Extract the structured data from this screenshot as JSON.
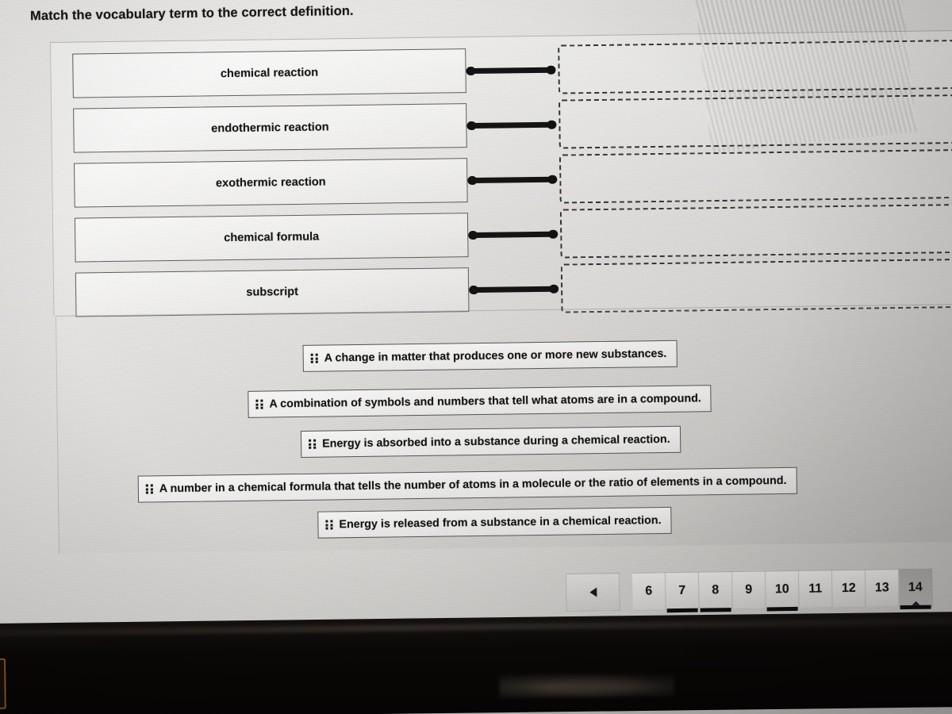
{
  "prompt": "Match the vocabulary term to the correct definition.",
  "match_area": {
    "rows": [
      {
        "term": "chemical reaction",
        "connector": "link-connector",
        "drop_zone_placeholder": ""
      },
      {
        "term": "endothermic reaction",
        "connector": "link-connector",
        "drop_zone_placeholder": ""
      },
      {
        "term": "exothermic reaction",
        "connector": "link-connector",
        "drop_zone_placeholder": ""
      },
      {
        "term": "chemical formula",
        "connector": "link-connector",
        "drop_zone_placeholder": ""
      },
      {
        "term": "subscript",
        "connector": "link-connector",
        "drop_zone_placeholder": ""
      }
    ]
  },
  "definition_bank": {
    "items": [
      {
        "text": "A change in matter that produces one or more new substances."
      },
      {
        "text": "A combination of symbols and numbers that tell what atoms are in a compound."
      },
      {
        "text": "Energy is absorbed into a substance during a chemical reaction."
      },
      {
        "text": "A number in a chemical formula that tells the number of atoms in a molecule or the ratio of elements in a compound."
      },
      {
        "text": "Energy is released from a substance in a chemical reaction."
      }
    ]
  },
  "pagination": {
    "prev_label": "",
    "prev_icon": "triangle-left-icon",
    "pages": [
      {
        "label": "6",
        "active": false,
        "marked": false
      },
      {
        "label": "7",
        "active": false,
        "marked": true
      },
      {
        "label": "8",
        "active": false,
        "marked": true
      },
      {
        "label": "9",
        "active": false,
        "marked": false
      },
      {
        "label": "10",
        "active": false,
        "marked": true
      },
      {
        "label": "11",
        "active": false,
        "marked": false
      },
      {
        "label": "12",
        "active": false,
        "marked": false
      },
      {
        "label": "13",
        "active": false,
        "marked": false
      },
      {
        "label": "14",
        "active": true,
        "marked": true
      }
    ]
  },
  "colors": {
    "text": "#151515",
    "box_border": "#5e5e5e",
    "connector": "#141414",
    "dashed_border": "#333333",
    "bezel": "#0a0806",
    "corner_tab_accent": "#c2763a"
  }
}
